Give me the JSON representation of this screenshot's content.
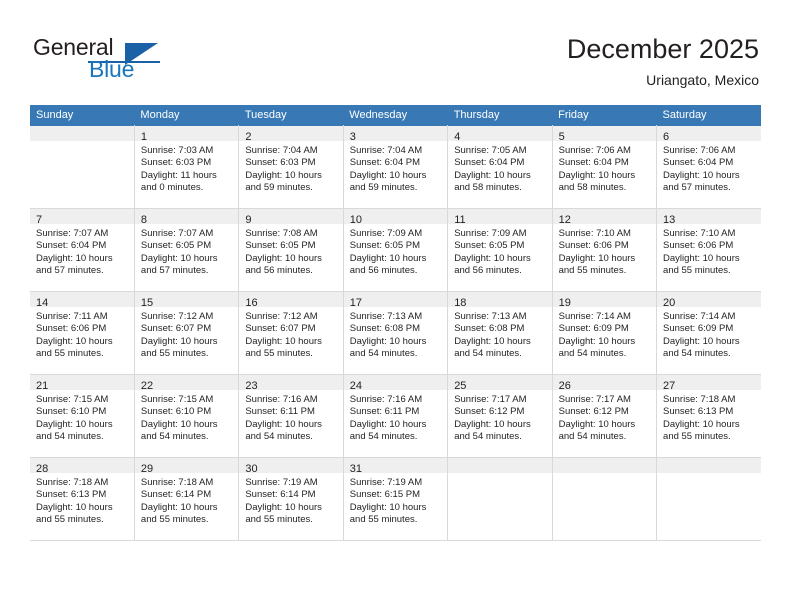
{
  "brand": {
    "word_general": "General",
    "word_blue": "Blue"
  },
  "header": {
    "title": "December 2025",
    "location": "Uriangato, Mexico"
  },
  "colors": {
    "header_blue": "#3878B4",
    "brand_blue": "#1B75BB",
    "daynum_band": "#EFEFEF",
    "grid_line": "#D9D9D9",
    "text": "#231F20"
  },
  "weekdays": [
    "Sunday",
    "Monday",
    "Tuesday",
    "Wednesday",
    "Thursday",
    "Friday",
    "Saturday"
  ],
  "weeks": [
    [
      {
        "day": "",
        "lines": [
          "",
          "",
          "",
          ""
        ]
      },
      {
        "day": "1",
        "lines": [
          "Sunrise: 7:03 AM",
          "Sunset: 6:03 PM",
          "Daylight: 11 hours",
          "and 0 minutes."
        ]
      },
      {
        "day": "2",
        "lines": [
          "Sunrise: 7:04 AM",
          "Sunset: 6:03 PM",
          "Daylight: 10 hours",
          "and 59 minutes."
        ]
      },
      {
        "day": "3",
        "lines": [
          "Sunrise: 7:04 AM",
          "Sunset: 6:04 PM",
          "Daylight: 10 hours",
          "and 59 minutes."
        ]
      },
      {
        "day": "4",
        "lines": [
          "Sunrise: 7:05 AM",
          "Sunset: 6:04 PM",
          "Daylight: 10 hours",
          "and 58 minutes."
        ]
      },
      {
        "day": "5",
        "lines": [
          "Sunrise: 7:06 AM",
          "Sunset: 6:04 PM",
          "Daylight: 10 hours",
          "and 58 minutes."
        ]
      },
      {
        "day": "6",
        "lines": [
          "Sunrise: 7:06 AM",
          "Sunset: 6:04 PM",
          "Daylight: 10 hours",
          "and 57 minutes."
        ]
      }
    ],
    [
      {
        "day": "7",
        "lines": [
          "Sunrise: 7:07 AM",
          "Sunset: 6:04 PM",
          "Daylight: 10 hours",
          "and 57 minutes."
        ]
      },
      {
        "day": "8",
        "lines": [
          "Sunrise: 7:07 AM",
          "Sunset: 6:05 PM",
          "Daylight: 10 hours",
          "and 57 minutes."
        ]
      },
      {
        "day": "9",
        "lines": [
          "Sunrise: 7:08 AM",
          "Sunset: 6:05 PM",
          "Daylight: 10 hours",
          "and 56 minutes."
        ]
      },
      {
        "day": "10",
        "lines": [
          "Sunrise: 7:09 AM",
          "Sunset: 6:05 PM",
          "Daylight: 10 hours",
          "and 56 minutes."
        ]
      },
      {
        "day": "11",
        "lines": [
          "Sunrise: 7:09 AM",
          "Sunset: 6:05 PM",
          "Daylight: 10 hours",
          "and 56 minutes."
        ]
      },
      {
        "day": "12",
        "lines": [
          "Sunrise: 7:10 AM",
          "Sunset: 6:06 PM",
          "Daylight: 10 hours",
          "and 55 minutes."
        ]
      },
      {
        "day": "13",
        "lines": [
          "Sunrise: 7:10 AM",
          "Sunset: 6:06 PM",
          "Daylight: 10 hours",
          "and 55 minutes."
        ]
      }
    ],
    [
      {
        "day": "14",
        "lines": [
          "Sunrise: 7:11 AM",
          "Sunset: 6:06 PM",
          "Daylight: 10 hours",
          "and 55 minutes."
        ]
      },
      {
        "day": "15",
        "lines": [
          "Sunrise: 7:12 AM",
          "Sunset: 6:07 PM",
          "Daylight: 10 hours",
          "and 55 minutes."
        ]
      },
      {
        "day": "16",
        "lines": [
          "Sunrise: 7:12 AM",
          "Sunset: 6:07 PM",
          "Daylight: 10 hours",
          "and 55 minutes."
        ]
      },
      {
        "day": "17",
        "lines": [
          "Sunrise: 7:13 AM",
          "Sunset: 6:08 PM",
          "Daylight: 10 hours",
          "and 54 minutes."
        ]
      },
      {
        "day": "18",
        "lines": [
          "Sunrise: 7:13 AM",
          "Sunset: 6:08 PM",
          "Daylight: 10 hours",
          "and 54 minutes."
        ]
      },
      {
        "day": "19",
        "lines": [
          "Sunrise: 7:14 AM",
          "Sunset: 6:09 PM",
          "Daylight: 10 hours",
          "and 54 minutes."
        ]
      },
      {
        "day": "20",
        "lines": [
          "Sunrise: 7:14 AM",
          "Sunset: 6:09 PM",
          "Daylight: 10 hours",
          "and 54 minutes."
        ]
      }
    ],
    [
      {
        "day": "21",
        "lines": [
          "Sunrise: 7:15 AM",
          "Sunset: 6:10 PM",
          "Daylight: 10 hours",
          "and 54 minutes."
        ]
      },
      {
        "day": "22",
        "lines": [
          "Sunrise: 7:15 AM",
          "Sunset: 6:10 PM",
          "Daylight: 10 hours",
          "and 54 minutes."
        ]
      },
      {
        "day": "23",
        "lines": [
          "Sunrise: 7:16 AM",
          "Sunset: 6:11 PM",
          "Daylight: 10 hours",
          "and 54 minutes."
        ]
      },
      {
        "day": "24",
        "lines": [
          "Sunrise: 7:16 AM",
          "Sunset: 6:11 PM",
          "Daylight: 10 hours",
          "and 54 minutes."
        ]
      },
      {
        "day": "25",
        "lines": [
          "Sunrise: 7:17 AM",
          "Sunset: 6:12 PM",
          "Daylight: 10 hours",
          "and 54 minutes."
        ]
      },
      {
        "day": "26",
        "lines": [
          "Sunrise: 7:17 AM",
          "Sunset: 6:12 PM",
          "Daylight: 10 hours",
          "and 54 minutes."
        ]
      },
      {
        "day": "27",
        "lines": [
          "Sunrise: 7:18 AM",
          "Sunset: 6:13 PM",
          "Daylight: 10 hours",
          "and 55 minutes."
        ]
      }
    ],
    [
      {
        "day": "28",
        "lines": [
          "Sunrise: 7:18 AM",
          "Sunset: 6:13 PM",
          "Daylight: 10 hours",
          "and 55 minutes."
        ]
      },
      {
        "day": "29",
        "lines": [
          "Sunrise: 7:18 AM",
          "Sunset: 6:14 PM",
          "Daylight: 10 hours",
          "and 55 minutes."
        ]
      },
      {
        "day": "30",
        "lines": [
          "Sunrise: 7:19 AM",
          "Sunset: 6:14 PM",
          "Daylight: 10 hours",
          "and 55 minutes."
        ]
      },
      {
        "day": "31",
        "lines": [
          "Sunrise: 7:19 AM",
          "Sunset: 6:15 PM",
          "Daylight: 10 hours",
          "and 55 minutes."
        ]
      },
      {
        "day": "",
        "lines": [
          "",
          "",
          "",
          ""
        ]
      },
      {
        "day": "",
        "lines": [
          "",
          "",
          "",
          ""
        ]
      },
      {
        "day": "",
        "lines": [
          "",
          "",
          "",
          ""
        ]
      }
    ]
  ]
}
